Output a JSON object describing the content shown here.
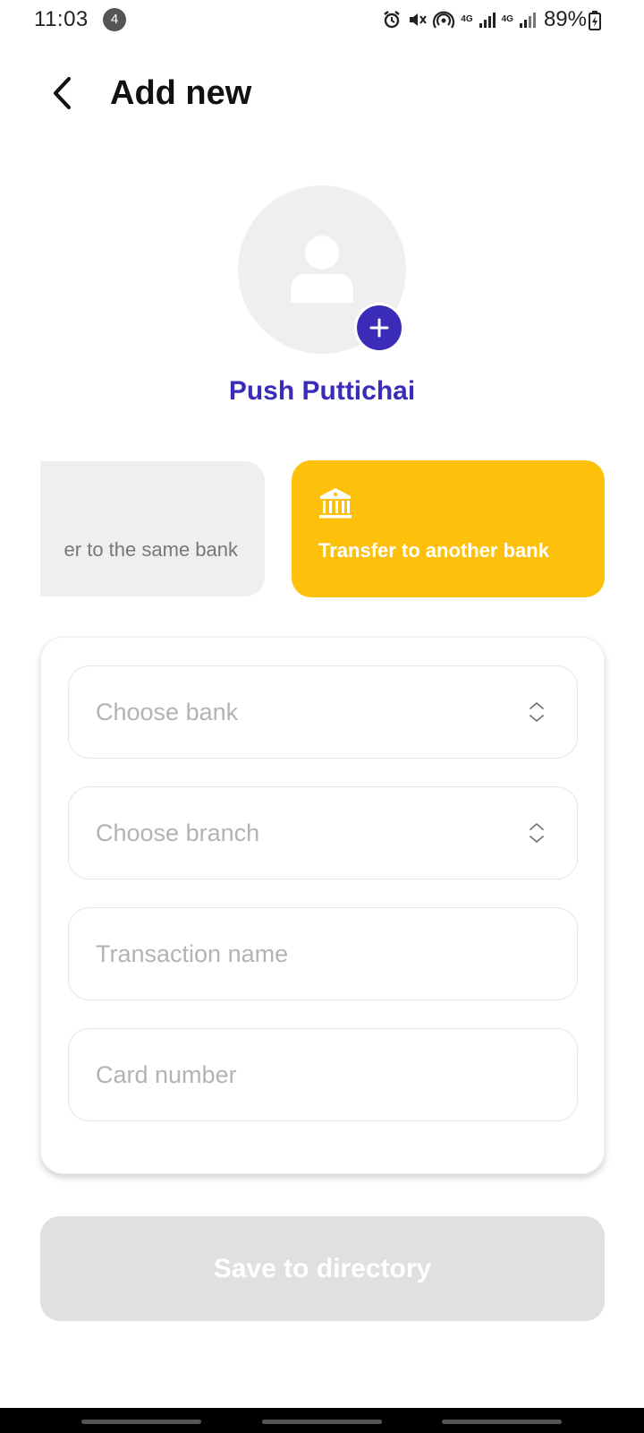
{
  "status_bar": {
    "time": "11:03",
    "notification_count": "4",
    "network_1": "4G",
    "network_2": "4G",
    "battery": "89%"
  },
  "header": {
    "title": "Add new",
    "back_icon": "chevron-left-icon"
  },
  "contact": {
    "name": "Push Puttichai",
    "avatar_icon": "person-icon",
    "add_photo_icon": "plus-icon"
  },
  "transfer_options": [
    {
      "label": "Transfer to the same bank",
      "visible_label": "er to the same bank",
      "selected": false
    },
    {
      "label": "Transfer to another bank",
      "selected": true,
      "icon": "bank-icon"
    }
  ],
  "form": {
    "bank_placeholder": "Choose bank",
    "branch_placeholder": "Choose branch",
    "transaction_name_placeholder": "Transaction name",
    "card_number_placeholder": "Card number"
  },
  "actions": {
    "save_label": "Save to directory"
  },
  "colors": {
    "primary": "#3a2bb8",
    "accent": "#fdc10b",
    "disabled": "#e0e0e0"
  }
}
